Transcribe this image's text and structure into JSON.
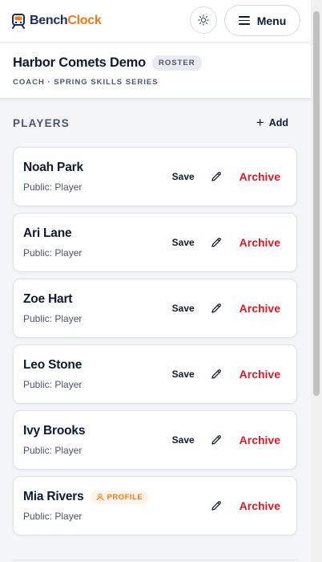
{
  "brand": {
    "name_part1": "Bench",
    "name_part2": "Clock",
    "logo_icon": "train-icon"
  },
  "topbar": {
    "menu_label": "Menu",
    "theme_icon": "sun-icon"
  },
  "team": {
    "name": "Harbor Comets Demo",
    "badge": "ROSTER",
    "subtitle": "COACH · SPRING SKILLS SERIES"
  },
  "players_section": {
    "title": "PLAYERS",
    "add_label": "Add"
  },
  "players": [
    {
      "name": "Noah Park",
      "visibility": "Public: Player",
      "save_label": "Save",
      "archive_label": "Archive"
    },
    {
      "name": "Ari Lane",
      "visibility": "Public: Player",
      "save_label": "Save",
      "archive_label": "Archive"
    },
    {
      "name": "Zoe Hart",
      "visibility": "Public: Player",
      "save_label": "Save",
      "archive_label": "Archive"
    },
    {
      "name": "Leo Stone",
      "visibility": "Public: Player",
      "save_label": "Save",
      "archive_label": "Archive"
    },
    {
      "name": "Ivy Brooks",
      "visibility": "Public: Player",
      "save_label": "Save",
      "archive_label": "Archive"
    },
    {
      "name": "Mia Rivers",
      "visibility": "Public: Player",
      "badge": "PROFILE",
      "archive_label": "Archive"
    }
  ],
  "colors": {
    "brand_navy": "#1c2d59",
    "brand_orange": "#f07a1a",
    "archive_red": "#d91c2a"
  }
}
